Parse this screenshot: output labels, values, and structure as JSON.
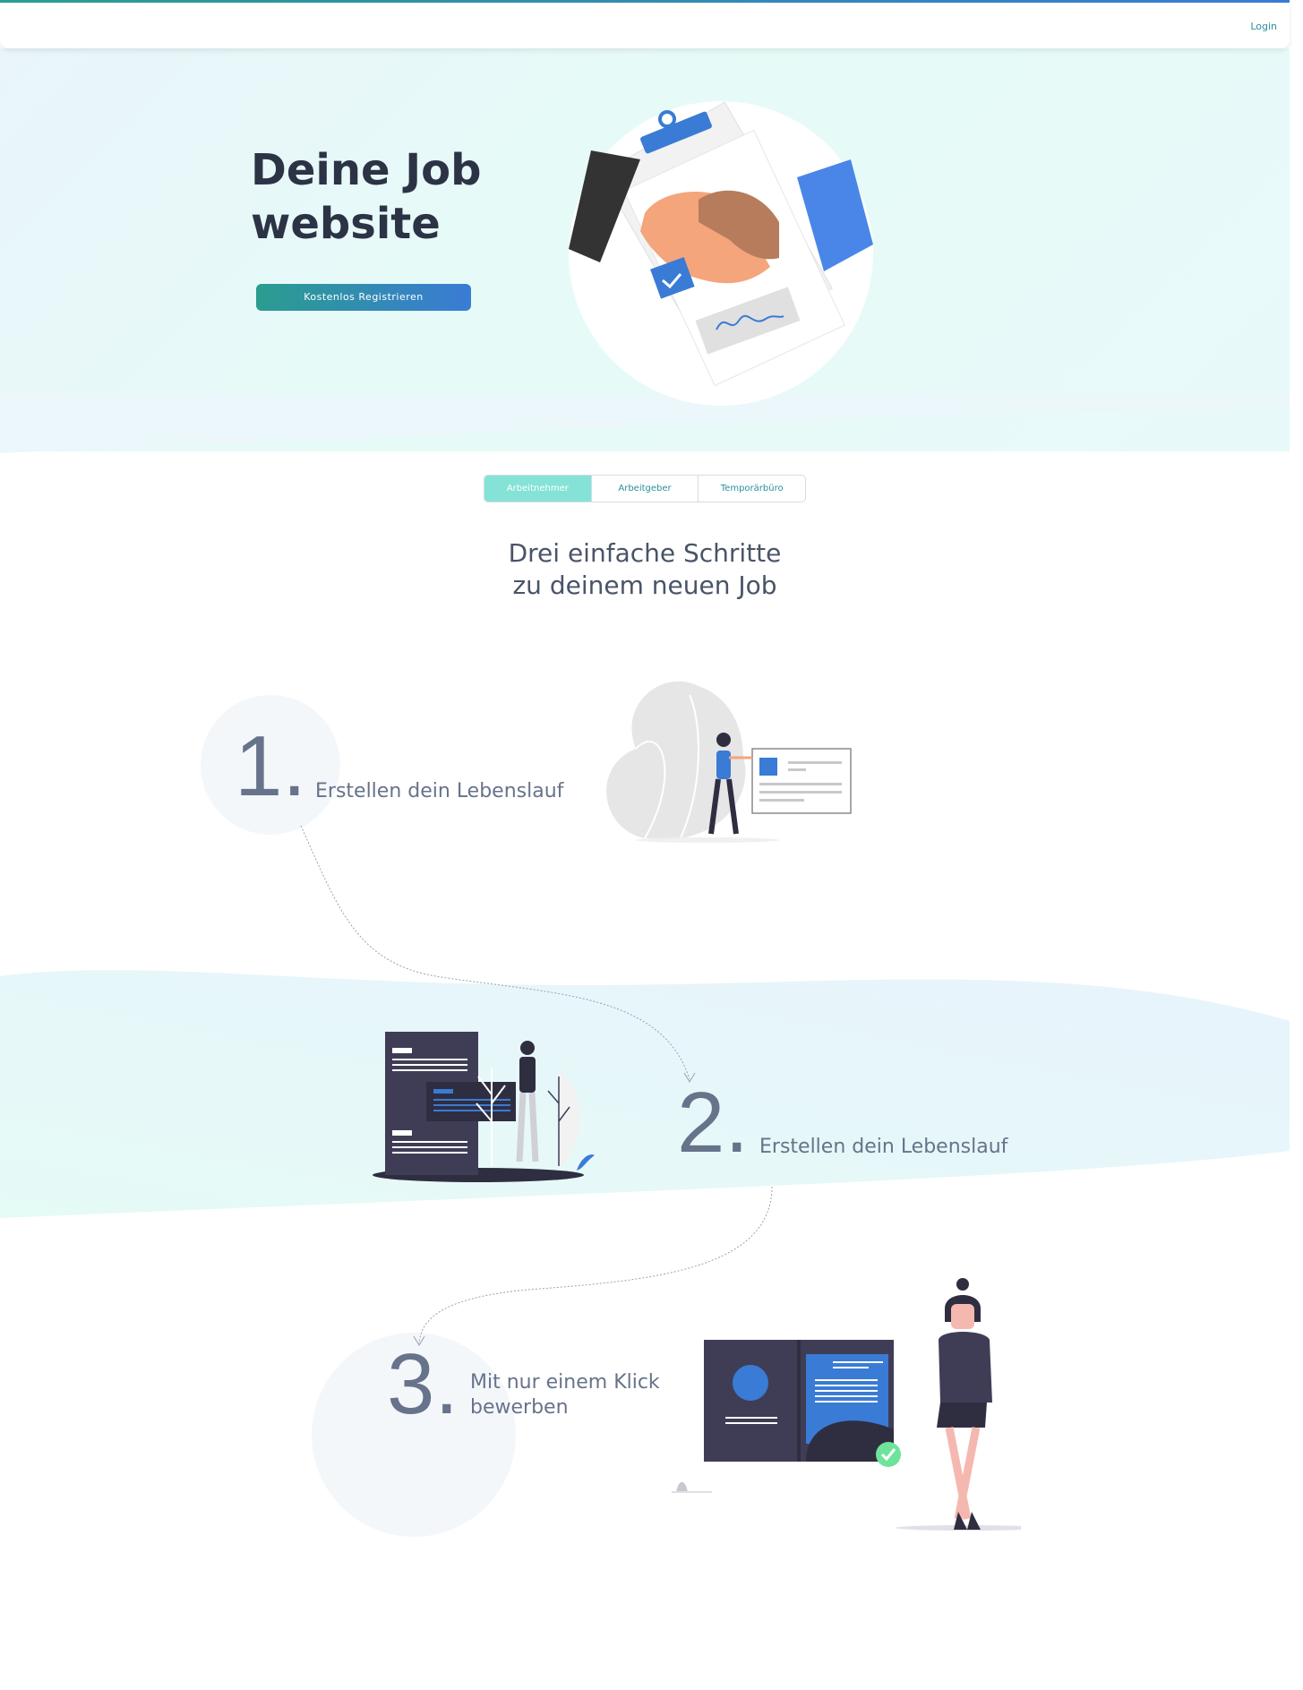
{
  "header": {
    "login_label": "Login"
  },
  "hero": {
    "title": "Deine Job website",
    "cta_label": "Kostenlos Registrieren"
  },
  "tabs": [
    {
      "label": "Arbeitnehmer",
      "active": true
    },
    {
      "label": "Arbeitgeber",
      "active": false
    },
    {
      "label": "Temporärbüro",
      "active": false
    }
  ],
  "section": {
    "title_line1": "Drei einfache Schritte",
    "title_line2": "zu deinem neuen Job"
  },
  "steps": [
    {
      "number": "1.",
      "text": "Erstellen dein Lebenslauf"
    },
    {
      "number": "2.",
      "text": "Erstellen dein Lebenslauf"
    },
    {
      "number": "3.",
      "text_line1": "Mit nur einem Klick",
      "text_line2": "bewerben"
    }
  ],
  "colors": {
    "accent_teal": "#2a9d8f",
    "accent_blue": "#3a7bd5",
    "tab_active": "#84e3d6",
    "text_dark": "#2b3345",
    "text_muted": "#67738a"
  }
}
